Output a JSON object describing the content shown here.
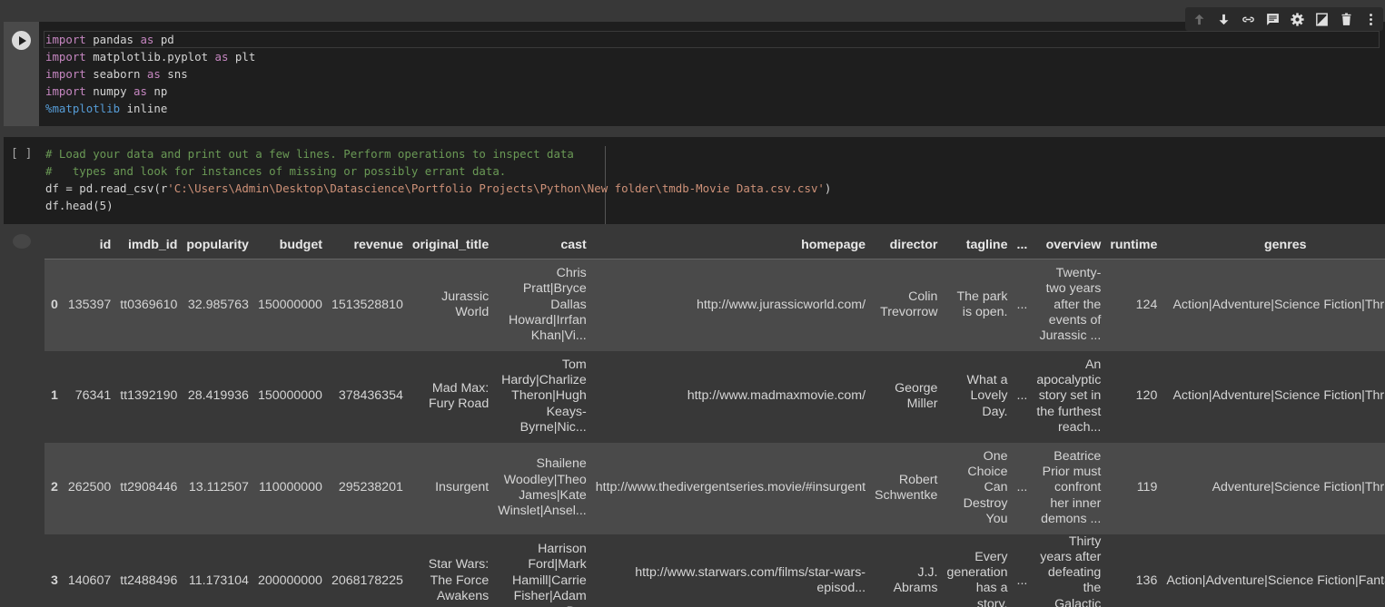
{
  "cell1": {
    "lines": [
      {
        "kw": "import",
        "rest": " pandas ",
        "kw2": "as",
        "rest2": " pd"
      },
      {
        "kw": "import",
        "rest": " matplotlib.pyplot ",
        "kw2": "as",
        "rest2": " plt"
      },
      {
        "kw": "import",
        "rest": " seaborn ",
        "kw2": "as",
        "rest2": " sns"
      },
      {
        "kw": "import",
        "rest": " numpy ",
        "kw2": "as",
        "rest2": " np"
      }
    ],
    "magic": "%matplotlib",
    "magic_rest": " inline"
  },
  "toolbar": {
    "icons": [
      "arrow-up-icon",
      "arrow-down-icon",
      "link-icon",
      "comment-icon",
      "gear-icon",
      "mirror-cell-icon",
      "delete-icon",
      "more-vert-icon"
    ]
  },
  "cell2": {
    "prompt": "[ ]",
    "comment1": "# Load your data and print out a few lines. Perform operations to inspect data",
    "comment2": "#   types and look for instances of missing or possibly errant data.",
    "line3_a": "df = pd.read_csv(r",
    "line3_str": "'C:\\Users\\Admin\\Desktop\\Datascience\\Portfolio Projects\\Python\\New folder\\tmdb-Movie Data.csv.csv'",
    "line3_b": ")",
    "line4": "df.head(5)"
  },
  "table": {
    "columns": [
      "",
      "id",
      "imdb_id",
      "popularity",
      "budget",
      "revenue",
      "original_title",
      "cast",
      "homepage",
      "director",
      "tagline",
      "...",
      "overview",
      "runtime",
      "genres"
    ],
    "rows": [
      [
        "0",
        "135397",
        "tt0369610",
        "32.985763",
        "150000000",
        "1513528810",
        "Jurassic World",
        "Chris Pratt|Bryce Dallas Howard|Irrfan Khan|Vi...",
        "http://www.jurassicworld.com/",
        "Colin Trevorrow",
        "The park is open.",
        "...",
        "Twenty-two years after the events of Jurassic ...",
        "124",
        "Action|Adventure|Science Fiction|Thriller"
      ],
      [
        "1",
        "76341",
        "tt1392190",
        "28.419936",
        "150000000",
        "378436354",
        "Mad Max: Fury Road",
        "Tom Hardy|Charlize Theron|Hugh Keays-Byrne|Nic...",
        "http://www.madmaxmovie.com/",
        "George Miller",
        "What a Lovely Day.",
        "...",
        "An apocalyptic story set in the furthest reach...",
        "120",
        "Action|Adventure|Science Fiction|Thriller"
      ],
      [
        "2",
        "262500",
        "tt2908446",
        "13.112507",
        "110000000",
        "295238201",
        "Insurgent",
        "Shailene Woodley|Theo James|Kate Winslet|Ansel...",
        "http://www.thedivergentseries.movie/#insurgent",
        "Robert Schwentke",
        "One Choice Can Destroy You",
        "...",
        "Beatrice Prior must confront her inner demons ...",
        "119",
        "Adventure|Science Fiction|Thriller"
      ],
      [
        "3",
        "140607",
        "tt2488496",
        "11.173104",
        "200000000",
        "2068178225",
        "Star Wars: The Force Awakens",
        "Harrison Ford|Mark Hamill|Carrie Fisher|Adam D...",
        "http://www.starwars.com/films/star-wars-episod...",
        "J.J. Abrams",
        "Every generation has a story.",
        "...",
        "Thirty years after defeating the Galactic Empi...",
        "136",
        "Action|Adventure|Science Fiction|Fantasy"
      ]
    ]
  }
}
